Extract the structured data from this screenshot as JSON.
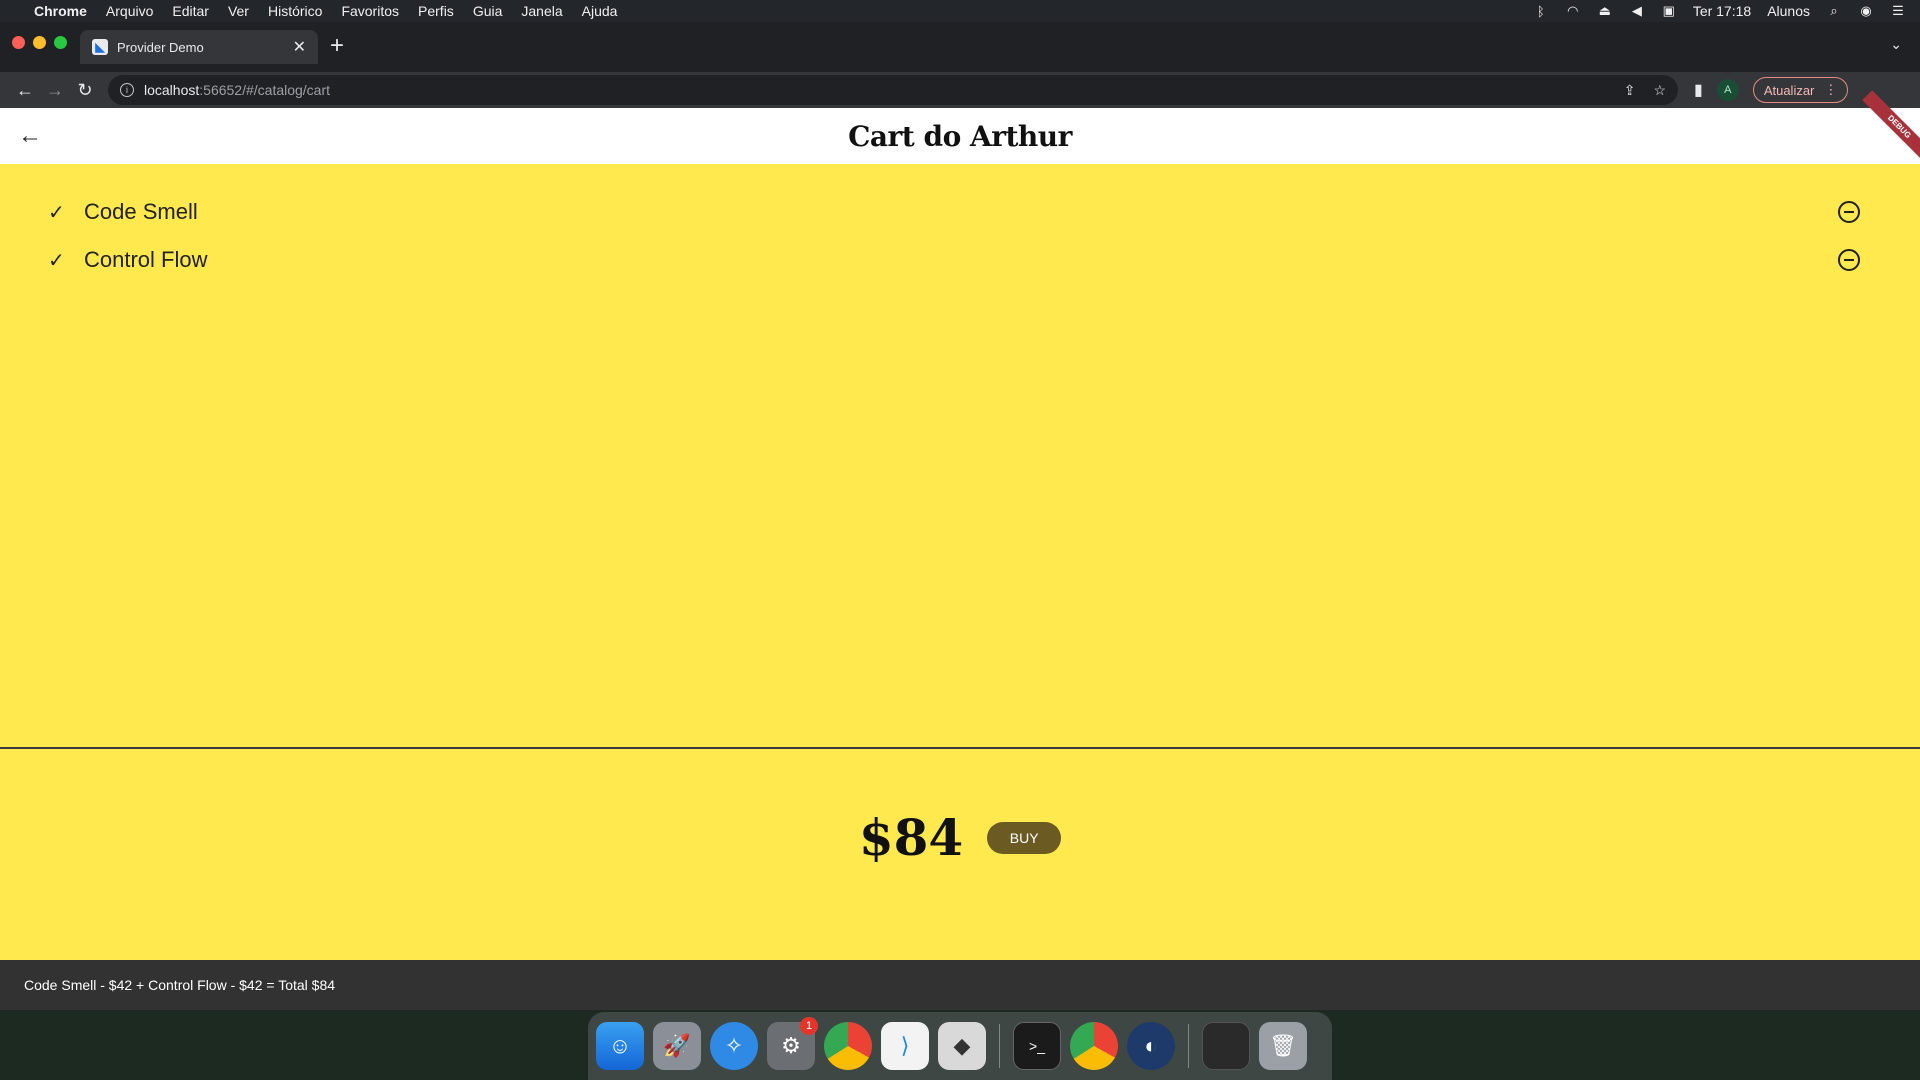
{
  "menubar": {
    "app_name": "Chrome",
    "items": [
      "Arquivo",
      "Editar",
      "Ver",
      "Histórico",
      "Favoritos",
      "Perfis",
      "Guia",
      "Janela",
      "Ajuda"
    ],
    "clock": "Ter 17:18",
    "user": "Alunos"
  },
  "browser": {
    "tab_title": "Provider Demo",
    "url_host": "localhost",
    "url_path": ":56652/#/catalog/cart",
    "profile_initial": "A",
    "update_label": "Atualizar"
  },
  "app": {
    "title": "Cart do Arthur",
    "debug_banner": "DEBUG",
    "items": [
      {
        "name": "Code Smell"
      },
      {
        "name": "Control Flow"
      }
    ],
    "total": "$84",
    "buy_label": "BUY",
    "snackbar": "Code Smell - $42 + Control Flow - $42 = Total $84"
  },
  "dock": {
    "badge_count": "1"
  },
  "colors": {
    "page_background": "#ffe94e",
    "buy_button": "#6b5a22",
    "snackbar": "#323232"
  }
}
